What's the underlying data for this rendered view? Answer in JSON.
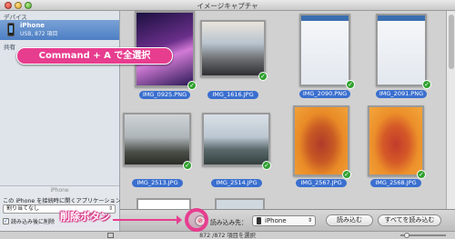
{
  "window": {
    "title": "イメージキャプチャ"
  },
  "sidebar": {
    "devices_header": "デバイス",
    "device_name": "iPhone",
    "device_sub": "USB, 872 項目",
    "shared_header": "共有",
    "panel_device_label": "iPhone",
    "connect_question": "この iPhone を接続時に開くアプリケーション：",
    "connect_app": "割り当てなし",
    "delete_after_label": "読み込み後に削除"
  },
  "thumbnails": [
    {
      "label": "IMG_0925.PNG"
    },
    {
      "label": "IMG_1616.JPG"
    },
    {
      "label": "IMG_2090.PNG"
    },
    {
      "label": "IMG_2091.PNG"
    },
    {
      "label": "IMG_2513.JPG"
    },
    {
      "label": "IMG_2514.JPG"
    },
    {
      "label": "IMG_2567.JPG"
    },
    {
      "label": "IMG_2568.JPG"
    }
  ],
  "toolbar": {
    "import_to_label": "読み込み先：",
    "destination": "iPhone",
    "import_button": "読み込む",
    "import_all_button": "すべてを読み込む"
  },
  "status": {
    "text": "872 /872 項目を選択"
  },
  "annotations": {
    "select_all": "Command + A で全選択",
    "delete_button": "削除ボタン"
  },
  "colors": {
    "accent": "#e73d8f",
    "label_blue": "#3a6fcf",
    "check_green": "#2fa12f"
  }
}
